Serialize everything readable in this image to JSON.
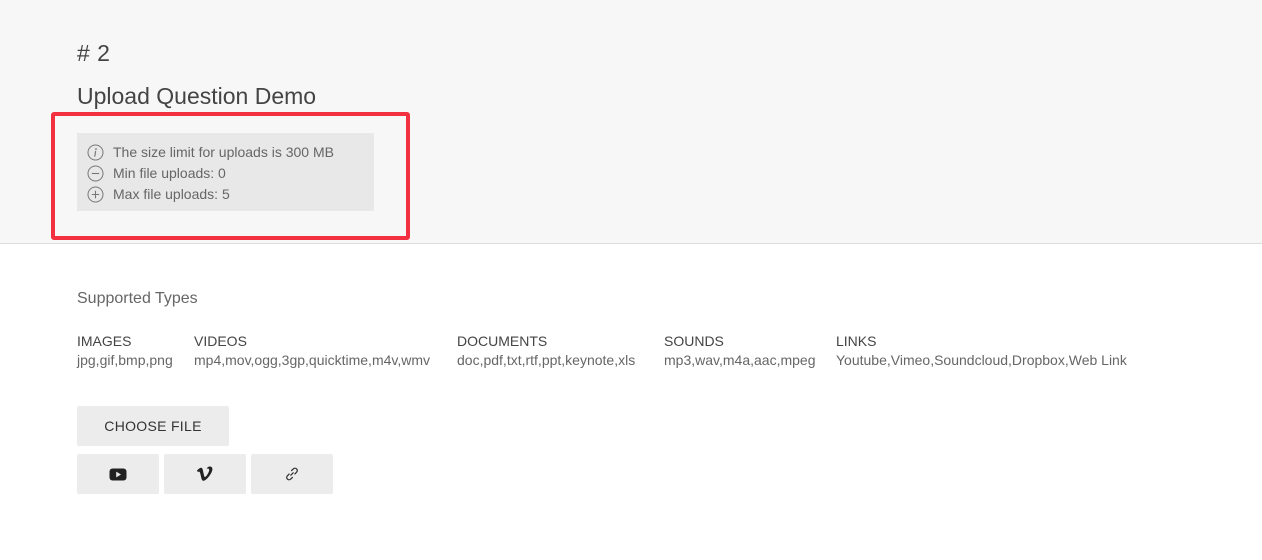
{
  "question": {
    "number": "# 2",
    "title": "Upload Question Demo"
  },
  "limits": {
    "size_limit": "The size limit for uploads is 300 MB",
    "min_uploads": "Min file uploads: 0",
    "max_uploads": "Max file uploads: 5",
    "icons": [
      "info-icon",
      "minus-circle-icon",
      "plus-circle-icon"
    ]
  },
  "highlight": {
    "color": "#f2303f"
  },
  "supported": {
    "title": "Supported Types",
    "types": [
      {
        "name": "IMAGES",
        "extensions": "jpg,gif,bmp,png"
      },
      {
        "name": "VIDEOS",
        "extensions": "mp4,mov,ogg,3gp,quicktime,m4v,wmv"
      },
      {
        "name": "DOCUMENTS",
        "extensions": "doc,pdf,txt,rtf,ppt,keynote,xls"
      },
      {
        "name": "SOUNDS",
        "extensions": "mp3,wav,m4a,aac,mpeg"
      },
      {
        "name": "LINKS",
        "extensions": "Youtube,Vimeo,Soundcloud,Dropbox,Web Link"
      }
    ]
  },
  "actions": {
    "choose_file_label": "CHOOSE FILE",
    "icon_buttons": [
      "youtube-icon",
      "vimeo-icon",
      "link-icon"
    ]
  }
}
